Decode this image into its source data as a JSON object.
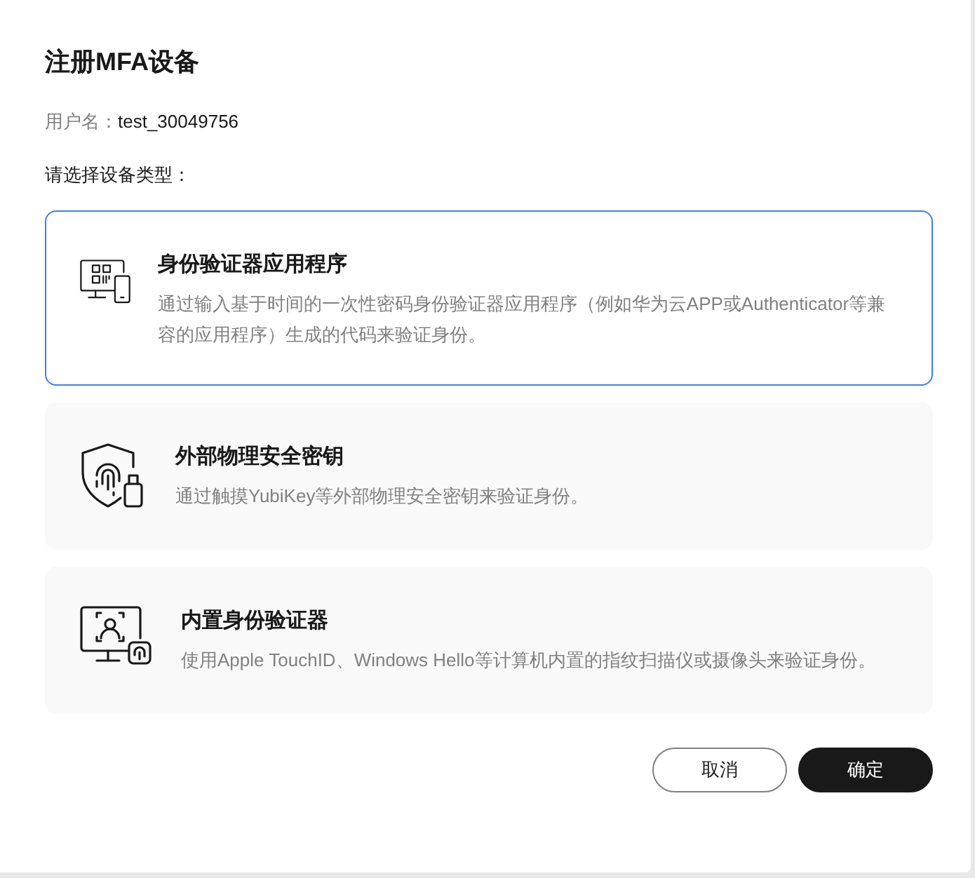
{
  "dialog": {
    "title": "注册MFA设备",
    "username_label": "用户名：",
    "username": "test_30049756",
    "prompt": "请选择设备类型："
  },
  "device_types": [
    {
      "kind": "app",
      "title": "身份验证器应用程序",
      "description": "通过输入基于时间的一次性密码身份验证器应用程序（例如华为云APP或Authenticator等兼容的应用程序）生成的代码来验证身份。",
      "selected": true
    },
    {
      "kind": "key",
      "title": "外部物理安全密钥",
      "description": "通过触摸YubiKey等外部物理安全密钥来验证身份。",
      "selected": false
    },
    {
      "kind": "builtin",
      "title": "内置身份验证器",
      "description": "使用Apple TouchID、Windows Hello等计算机内置的指纹扫描仪或摄像头来验证身份。",
      "selected": false
    }
  ],
  "buttons": [
    {
      "kind": "secondary",
      "label": "取消"
    },
    {
      "kind": "primary",
      "label": "确定"
    }
  ]
}
